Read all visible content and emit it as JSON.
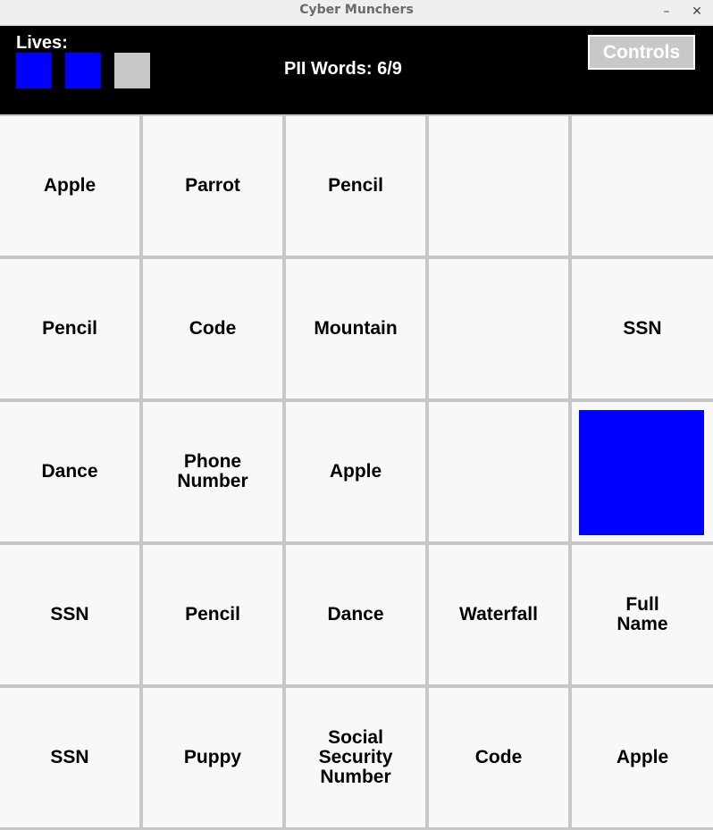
{
  "window": {
    "title": "Cyber Munchers",
    "minimize_glyph": "–",
    "close_glyph": "✕"
  },
  "hud": {
    "lives_label": "Lives:",
    "lives_total": 3,
    "lives_remaining": 2,
    "life_colors": [
      "#0000ff",
      "#0000ff",
      "#c8c8c8"
    ],
    "pii_counter": "PII Words: 6/9",
    "controls_label": "Controls"
  },
  "board": {
    "rows": 5,
    "cols": 5,
    "cells": [
      [
        "Apple",
        "Parrot",
        "Pencil",
        "",
        ""
      ],
      [
        "Pencil",
        "Code",
        "Mountain",
        "",
        "SSN"
      ],
      [
        "Dance",
        "Phone\nNumber",
        "Apple",
        "",
        ""
      ],
      [
        "SSN",
        "Pencil",
        "Dance",
        "Waterfall",
        "Full\nName"
      ],
      [
        "SSN",
        "Puppy",
        "Social\nSecurity\nNumber",
        "Code",
        "Apple"
      ]
    ],
    "player": {
      "row": 3,
      "col": 5,
      "color": "#0000ff"
    }
  }
}
